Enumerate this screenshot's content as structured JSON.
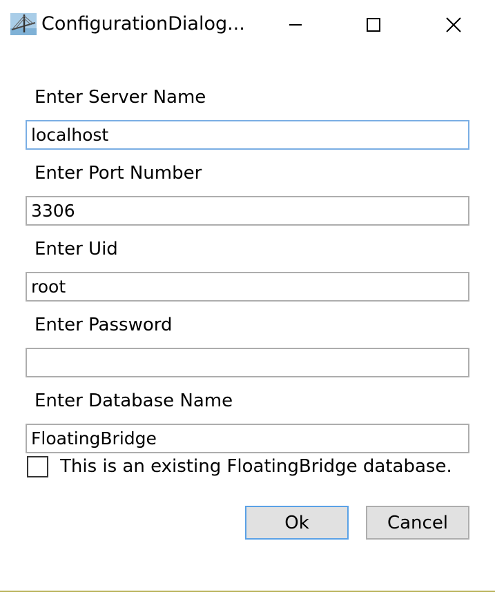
{
  "window": {
    "title": "ConfigurationDialog...",
    "controls": [
      "minimize-icon",
      "maximize-icon",
      "close-icon"
    ]
  },
  "form": {
    "server": {
      "label": "Enter Server Name",
      "value": "localhost"
    },
    "port": {
      "label": "Enter Port Number",
      "value": "3306"
    },
    "uid": {
      "label": "Enter Uid",
      "value": "root"
    },
    "password": {
      "label": "Enter Password",
      "value": ""
    },
    "database": {
      "label": "Enter Database Name",
      "value": "FloatingBridge"
    },
    "existing_checkbox": {
      "label": "This is an existing FloatingBridge database.",
      "checked": false
    }
  },
  "buttons": {
    "ok_label": "Ok",
    "cancel_label": "Cancel"
  },
  "colors": {
    "focus_border": "#7aaee4",
    "default_button_border": "#5aa1e6",
    "button_face": "#e1e1e1"
  }
}
